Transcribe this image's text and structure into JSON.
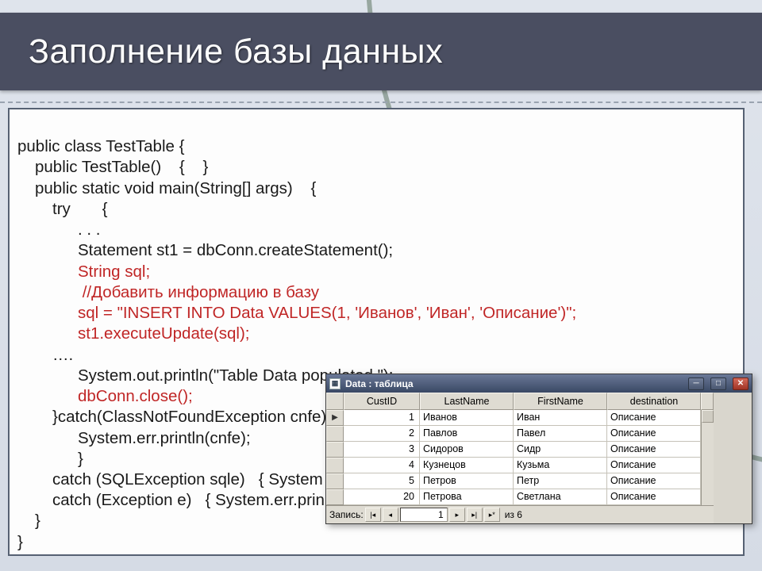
{
  "slide": {
    "title": "Заполнение базы данных"
  },
  "code": {
    "l1": "public class TestTable {",
    "l2": "public TestTable()    {    }",
    "l3": "public static void main(String[] args)    {",
    "l4": "try       {",
    "l5": ". . .",
    "l6": "Statement st1 = dbConn.createStatement();",
    "l7": "String sql;",
    "l8": " //Добавить информацию в базу",
    "l9": "sql = \"INSERT INTO Data VALUES(1, 'Иванов', 'Иван', 'Описание')\";",
    "l10": "st1.executeUpdate(sql);",
    "l11": "….",
    "l12": "System.out.println(\"Table Data populated \");",
    "l13": "dbConn.close();",
    "l14": "}catch(ClassNotFoundException cnfe)         {",
    "l15": "System.err.println(cnfe);",
    "l16": "}",
    "l17": "catch (SQLException sqle)   { System",
    "l18": "catch (Exception e)   { System.err.prin",
    "l19": "}",
    "l20": "}"
  },
  "db": {
    "window_title": "Data : таблица",
    "columns": {
      "c1": "CustID",
      "c2": "LastName",
      "c3": "FirstName",
      "c4": "destination"
    },
    "rows": [
      {
        "id": "1",
        "last": "Иванов",
        "first": "Иван",
        "dest": "Описание"
      },
      {
        "id": "2",
        "last": "Павлов",
        "first": "Павел",
        "dest": "Описание"
      },
      {
        "id": "3",
        "last": "Сидоров",
        "first": "Сидр",
        "dest": "Описание"
      },
      {
        "id": "4",
        "last": "Кузнецов",
        "first": "Кузьма",
        "dest": "Описание"
      },
      {
        "id": "5",
        "last": "Петров",
        "first": "Петр",
        "dest": "Описание"
      },
      {
        "id": "20",
        "last": "Петрова",
        "first": "Светлана",
        "dest": "Описание"
      }
    ],
    "nav": {
      "label": "Запись:",
      "first": "|◂",
      "prev": "◂",
      "current": "1",
      "next": "▸",
      "last": "▸|",
      "new": "▸*",
      "total": "из 6"
    }
  }
}
